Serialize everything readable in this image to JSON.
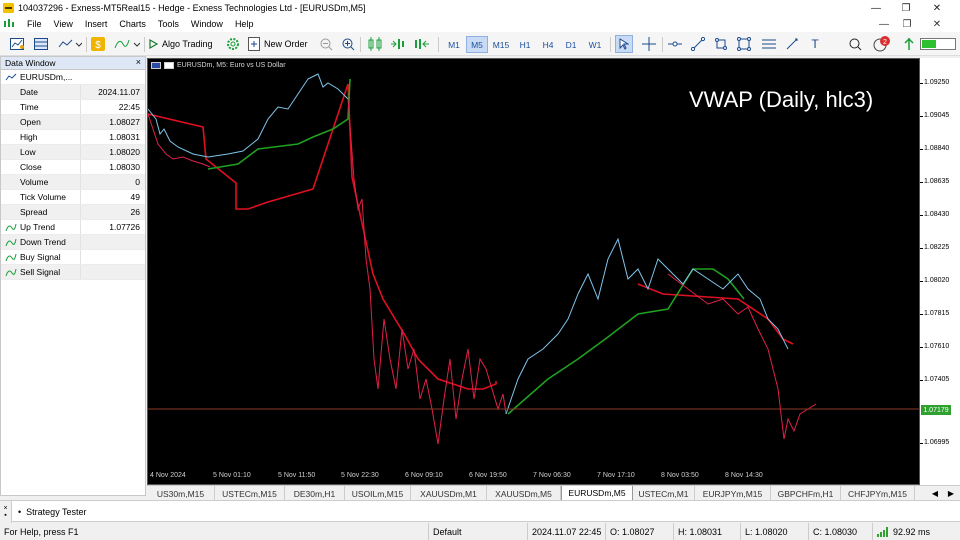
{
  "window": {
    "title": "104037296 - Exness-MT5Real15 - Hedge - Exness Technologies Ltd - [EURUSDm,M5]",
    "minimize": "—",
    "maximize": "❐",
    "close": "✕"
  },
  "menu": [
    "File",
    "View",
    "Insert",
    "Charts",
    "Tools",
    "Window",
    "Help"
  ],
  "toolbar": {
    "algo_trading": "Algo Trading",
    "new_order": "New Order",
    "timeframes": [
      "M1",
      "M5",
      "M15",
      "H1",
      "H4",
      "D1",
      "W1"
    ],
    "active_timeframe": "M5",
    "notification_count": "2"
  },
  "data_window": {
    "title": "Data Window",
    "symbol": "EURUSDm,...",
    "rows": [
      {
        "label": "Date",
        "value": "2024.11.07"
      },
      {
        "label": "Time",
        "value": "22:45"
      },
      {
        "label": "Open",
        "value": "1.08027"
      },
      {
        "label": "High",
        "value": "1.08031"
      },
      {
        "label": "Low",
        "value": "1.08020"
      },
      {
        "label": "Close",
        "value": "1.08030"
      },
      {
        "label": "Volume",
        "value": "0"
      },
      {
        "label": "Tick Volume",
        "value": "49"
      },
      {
        "label": "Spread",
        "value": "26"
      },
      {
        "label": "Up Trend",
        "value": "1.07726"
      },
      {
        "label": "Down Trend",
        "value": ""
      },
      {
        "label": "Buy Signal",
        "value": ""
      },
      {
        "label": "Sell Signal",
        "value": ""
      }
    ]
  },
  "chart": {
    "symbol_label": "EURUSDm, M5:  Euro vs US Dollar",
    "overlay_text": "VWAP (Daily, hlc3)",
    "current_price": "1.07179",
    "colors": {
      "background": "#000000",
      "up_candle": "#7fc4ea",
      "down_candle": "#e0204a",
      "vwap_up": "#1fa01f",
      "vwap_down": "#e01020",
      "price_line": "#8b3a2a"
    },
    "y_ticks": [
      "1.09250",
      "1.09045",
      "1.08840",
      "1.08635",
      "1.08430",
      "1.08225",
      "1.08020",
      "1.07815",
      "1.07610",
      "1.07405",
      "1.07179",
      "1.06995"
    ],
    "x_ticks": [
      "4 Nov 2024",
      "5 Nov 01:10",
      "5 Nov 11:50",
      "5 Nov 22:30",
      "6 Nov 09:10",
      "6 Nov 19:50",
      "7 Nov 06:30",
      "7 Nov 17:10",
      "8 Nov 03:50",
      "8 Nov 14:30"
    ]
  },
  "chart_tabs": [
    "US30m,M15",
    "USTECm,M15",
    "DE30m,H1",
    "USOILm,M15",
    "XAUUSDm,M1",
    "XAUUSDm,M5",
    "EURUSDm,M5",
    "USTECm,M1",
    "EURJPYm,M15",
    "GBPCHFm,H1",
    "CHFJPYm,M15"
  ],
  "active_tab": "EURUSDm,M5",
  "toolbox": {
    "strategy_tester": "Strategy Tester"
  },
  "status": {
    "help": "For Help, press F1",
    "profile": "Default",
    "datetime": "2024.11.07 22:45",
    "open": "O: 1.08027",
    "high": "H: 1.08031",
    "low": "L: 1.08020",
    "close": "C: 1.08030",
    "ping": "92.92 ms"
  }
}
